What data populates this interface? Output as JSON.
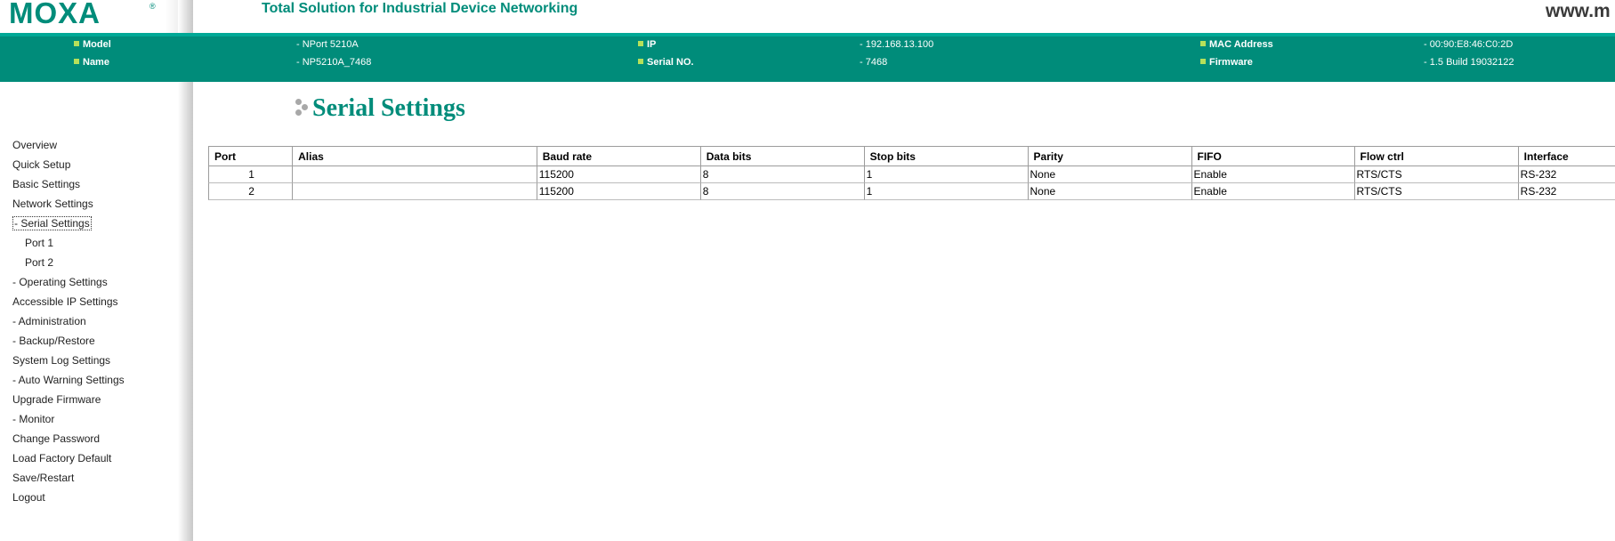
{
  "header": {
    "logo": "MOXA",
    "logo_mark": "®",
    "tagline": "Total Solution for Industrial Device Networking",
    "website": "www.m"
  },
  "device_info": {
    "model_label": "Model",
    "model_value": "- NPort 5210A",
    "name_label": "Name",
    "name_value": "- NP5210A_7468",
    "ip_label": "IP",
    "ip_value": "- 192.168.13.100",
    "serial_label": "Serial NO.",
    "serial_value": "- 7468",
    "mac_label": "MAC Address",
    "mac_value": "- 00:90:E8:46:C0:2D",
    "firmware_label": "Firmware",
    "firmware_value": "- 1.5 Build 19032122"
  },
  "nav": {
    "items": [
      "Overview",
      "Quick Setup",
      "Basic Settings",
      "Network Settings",
      "- Serial Settings",
      "Port 1",
      "Port 2",
      "- Operating Settings",
      "Accessible IP Settings",
      "- Administration",
      "- Backup/Restore",
      "System Log Settings",
      "- Auto Warning Settings",
      "Upgrade Firmware",
      "- Monitor",
      "Change Password",
      "Load Factory Default",
      "Save/Restart",
      "Logout"
    ]
  },
  "page": {
    "title": "Serial Settings"
  },
  "table": {
    "columns": [
      "Port",
      "Alias",
      "Baud rate",
      "Data bits",
      "Stop bits",
      "Parity",
      "FIFO",
      "Flow ctrl",
      "Interface"
    ],
    "rows": [
      [
        "1",
        "",
        "115200",
        "8",
        "1",
        "None",
        "Enable",
        "RTS/CTS",
        "RS-232"
      ],
      [
        "2",
        "",
        "115200",
        "8",
        "1",
        "None",
        "Enable",
        "RTS/CTS",
        "RS-232"
      ]
    ]
  },
  "colors": {
    "brand": "#008c7a",
    "bullet": "#b6e05a"
  }
}
